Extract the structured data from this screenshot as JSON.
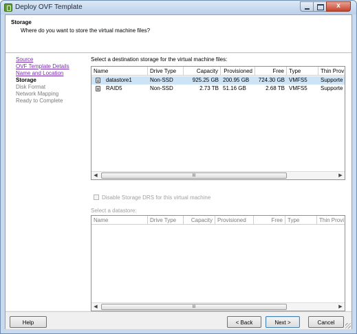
{
  "window": {
    "title": "Deploy OVF Template"
  },
  "header": {
    "title": "Storage",
    "subtitle": "Where do you want to store the virtual machine files?"
  },
  "steps": [
    {
      "label": "Source",
      "state": "link"
    },
    {
      "label": "OVF Template Details",
      "state": "link"
    },
    {
      "label": "Name and Location",
      "state": "link"
    },
    {
      "label": "Storage",
      "state": "current"
    },
    {
      "label": "Disk Format",
      "state": "pending"
    },
    {
      "label": "Network Mapping",
      "state": "pending"
    },
    {
      "label": "Ready to Complete",
      "state": "pending"
    }
  ],
  "storage": {
    "label": "Select a destination storage for the virtual machine files:",
    "columns": [
      "Name",
      "Drive Type",
      "Capacity",
      "Provisioned",
      "Free",
      "Type",
      "Thin Prov"
    ],
    "rows": [
      {
        "name": "datastore1",
        "drive_type": "Non-SSD",
        "capacity": "925.25 GB",
        "provisioned": "200.95 GB",
        "free": "724.30 GB",
        "type": "VMFS5",
        "thin": "Supporte"
      },
      {
        "name": "RAID5",
        "drive_type": "Non-SSD",
        "capacity": "2.73 TB",
        "provisioned": "51.16 GB",
        "free": "2.68 TB",
        "type": "VMFS5",
        "thin": "Supporte"
      }
    ],
    "scroll_thumb": "III"
  },
  "sdrs": {
    "label": "Disable Storage DRS for this virtual machine"
  },
  "datastore": {
    "label": "Select a datastore:",
    "columns": [
      "Name",
      "Drive Type",
      "Capacity",
      "Provisioned",
      "Free",
      "Type",
      "Thin Provi"
    ],
    "scroll_thumb": "III"
  },
  "footer": {
    "help": "Help",
    "back": "< Back",
    "next": "Next >",
    "cancel": "Cancel"
  },
  "caption": {
    "close": "x"
  }
}
